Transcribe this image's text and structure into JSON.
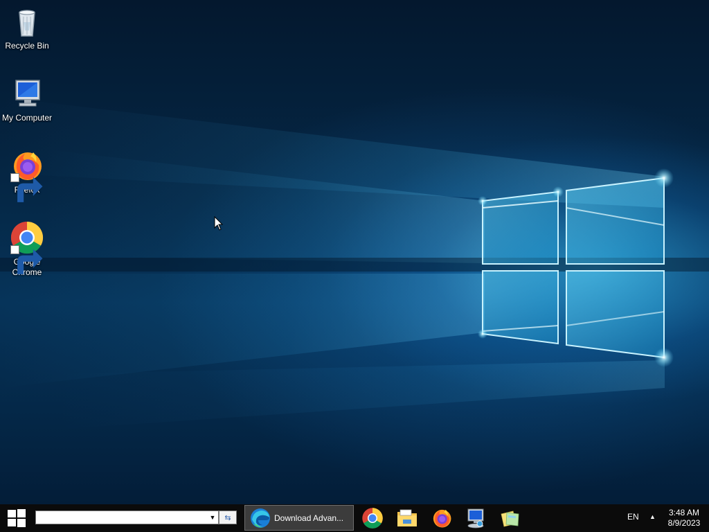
{
  "desktop": {
    "icons": [
      {
        "label": "Recycle Bin",
        "icon": "recycle-bin-icon"
      },
      {
        "label": "My Computer",
        "icon": "computer-icon"
      },
      {
        "label": "Firefox",
        "icon": "firefox-icon"
      },
      {
        "label": "Google\nChrome",
        "icon": "chrome-icon"
      }
    ]
  },
  "taskbar": {
    "address": {
      "value": "",
      "placeholder": ""
    },
    "running_task": {
      "label": "Download Advan...",
      "icon": "edge-icon"
    },
    "pinned": [
      {
        "icon": "chrome-icon"
      },
      {
        "icon": "file-explorer-icon"
      },
      {
        "icon": "firefox-icon"
      },
      {
        "icon": "computer-network-icon"
      },
      {
        "icon": "sticky-notes-icon"
      }
    ],
    "tray": {
      "language": "EN",
      "time": "3:48 AM",
      "date": "8/9/2023"
    }
  },
  "colors": {
    "taskbar_bg": "#0b0b0b",
    "wallpaper_glow": "#5fd0f5",
    "wallpaper_dark": "#04182e"
  }
}
